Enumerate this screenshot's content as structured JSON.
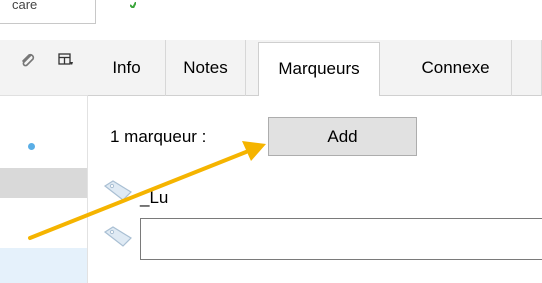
{
  "top_field": {
    "value": "care"
  },
  "tabs": [
    {
      "label": "Info"
    },
    {
      "label": "Notes"
    },
    {
      "label": "Marqueurs"
    },
    {
      "label": "Connexe"
    }
  ],
  "markers": {
    "count_label": "1 marqueur :",
    "add_label": "Add",
    "items": [
      {
        "name": "_Lu"
      }
    ],
    "new_tag_value": ""
  },
  "colors": {
    "annotation_arrow": "#f5b400",
    "selected_dot": "#5aaee6",
    "selected_row": "#e5f1fb"
  }
}
